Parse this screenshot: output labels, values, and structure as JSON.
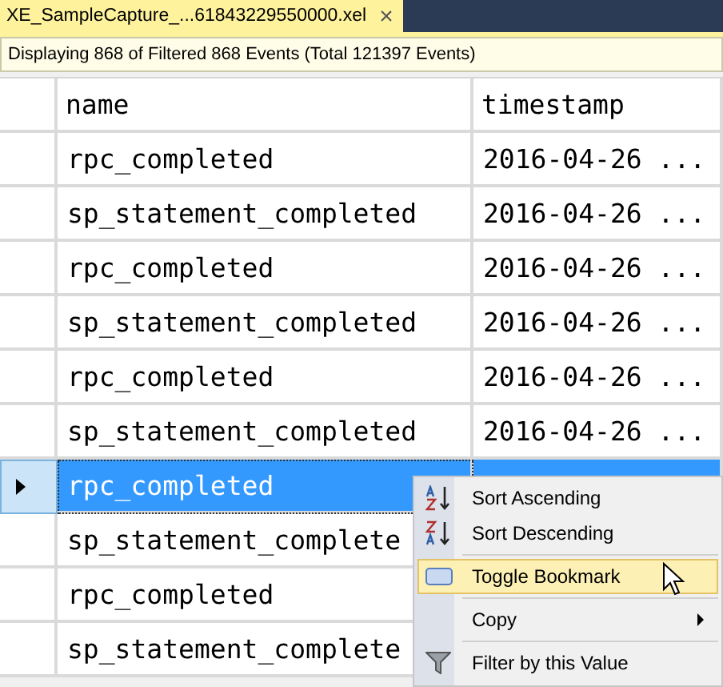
{
  "tab": {
    "title": "XE_SampleCapture_...61843229550000.xel",
    "close": "×",
    "selected": true
  },
  "info_bar": "Displaying 868 of Filtered 868 Events (Total 121397 Events)",
  "table": {
    "columns": [
      "name",
      "timestamp"
    ],
    "rows": [
      {
        "name": "rpc_completed",
        "timestamp": "2016-04-26  ...",
        "selected": false
      },
      {
        "name": "sp_statement_completed",
        "timestamp": "2016-04-26  ...",
        "selected": false
      },
      {
        "name": "rpc_completed",
        "timestamp": "2016-04-26  ...",
        "selected": false
      },
      {
        "name": "sp_statement_completed",
        "timestamp": "2016-04-26  ...",
        "selected": false
      },
      {
        "name": "rpc_completed",
        "timestamp": "2016-04-26  ...",
        "selected": false
      },
      {
        "name": "sp_statement_completed",
        "timestamp": "2016-04-26  ...",
        "selected": false
      },
      {
        "name": "rpc_completed",
        "selected": true
      },
      {
        "name": "sp_statement_complete",
        "selected": false
      },
      {
        "name": "rpc_completed",
        "selected": false
      },
      {
        "name": "sp_statement_complete",
        "selected": false
      }
    ]
  },
  "context_menu": {
    "groups": [
      [
        {
          "label": "Sort Ascending",
          "kind": "ascending",
          "highlighted": false,
          "submenu": false
        },
        {
          "label": "Sort Descending",
          "kind": "descending",
          "highlighted": false,
          "submenu": false
        }
      ],
      [
        {
          "label": "Toggle Bookmark",
          "kind": "bookmark",
          "highlighted": true,
          "submenu": false
        }
      ],
      [
        {
          "label": "Copy",
          "kind": "plain",
          "highlighted": false,
          "submenu": true
        }
      ],
      [
        {
          "label": "Filter by this Value",
          "kind": "filter",
          "highlighted": false,
          "submenu": false
        }
      ]
    ]
  }
}
